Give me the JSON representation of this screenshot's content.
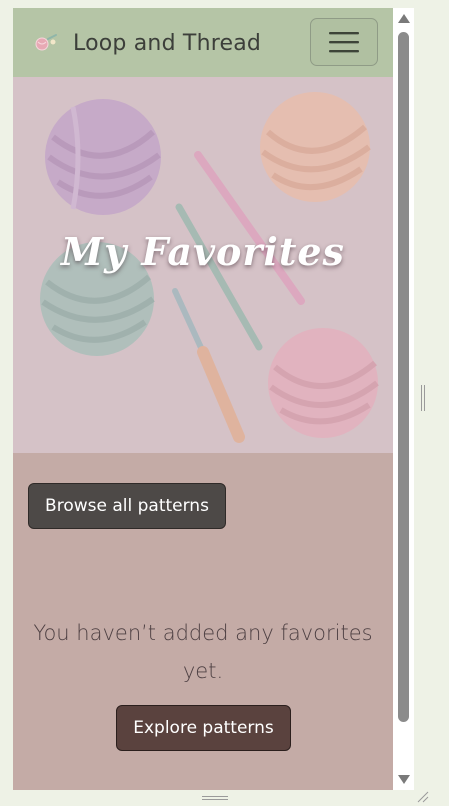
{
  "navbar": {
    "brand_name": "Loop and Thread",
    "brand_logo_icon": "yarn-ball-logo-icon",
    "menu_icon": "hamburger-menu-icon"
  },
  "hero": {
    "title": "My Favorites",
    "background_image": "yarn-balls-and-crochet-hooks-photo"
  },
  "actions": {
    "browse_label": "Browse all patterns",
    "explore_label": "Explore patterns"
  },
  "empty_state": {
    "message": "You haven’t added any favorites yet."
  },
  "colors": {
    "navbar_bg": "#b5c5a6",
    "page_bg": "#c4aba6",
    "browse_button_bg": "#4d4947",
    "explore_button_bg": "#5a423e"
  },
  "scrollbar": {
    "up_icon": "scroll-up-arrow-icon",
    "down_icon": "scroll-down-arrow-icon"
  }
}
